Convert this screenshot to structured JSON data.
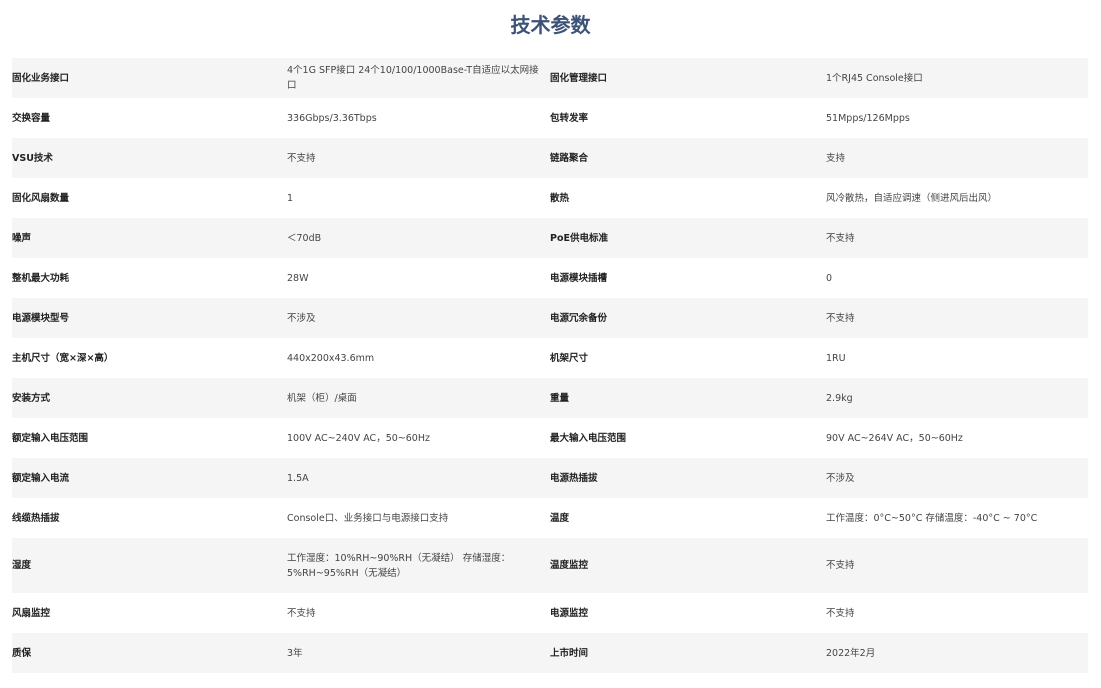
{
  "page": {
    "title": "技术参数"
  },
  "specs": [
    {
      "k1": "固化业务接口",
      "v1": "4个1G SFP接口 24个10/100/1000Base-T自适应以太网接口",
      "k2": "固化管理接口",
      "v2": "1个RJ45 Console接口"
    },
    {
      "k1": "交换容量",
      "v1": "336Gbps/3.36Tbps",
      "k2": "包转发率",
      "v2": "51Mpps/126Mpps"
    },
    {
      "k1": "VSU技术",
      "v1": "不支持",
      "k2": "链路聚合",
      "v2": "支持"
    },
    {
      "k1": "固化风扇数量",
      "v1": "1",
      "k2": "散热",
      "v2": "风冷散热，自适应调速（侧进风后出风）"
    },
    {
      "k1": "噪声",
      "v1": "＜70dB",
      "k2": "PoE供电标准",
      "v2": "不支持"
    },
    {
      "k1": "整机最大功耗",
      "v1": "28W",
      "k2": "电源模块插槽",
      "v2": "0"
    },
    {
      "k1": "电源模块型号",
      "v1": "不涉及",
      "k2": "电源冗余备份",
      "v2": "不支持"
    },
    {
      "k1": "主机尺寸（宽×深×高）",
      "v1": "440x200x43.6mm",
      "k2": "机架尺寸",
      "v2": "1RU"
    },
    {
      "k1": "安装方式",
      "v1": "机架（柜）/桌面",
      "k2": "重量",
      "v2": "2.9kg"
    },
    {
      "k1": "额定输入电压范围",
      "v1": "100V AC~240V AC，50~60Hz",
      "k2": "最大输入电压范围",
      "v2": "90V AC~264V AC，50~60Hz"
    },
    {
      "k1": "额定输入电流",
      "v1": "1.5A",
      "k2": "电源热插拔",
      "v2": "不涉及"
    },
    {
      "k1": "线缆热插拔",
      "v1": "Console口、业务接口与电源接口支持",
      "k2": "温度",
      "v2": "工作温度：0°C~50°C 存储温度：-40°C ~ 70°C"
    },
    {
      "k1": "湿度",
      "v1": "工作湿度：10%RH~90%RH（无凝结） 存储湿度：5%RH~95%RH（无凝结）",
      "k2": "温度监控",
      "v2": "不支持"
    },
    {
      "k1": "风扇监控",
      "v1": "不支持",
      "k2": "电源监控",
      "v2": "不支持"
    },
    {
      "k1": "质保",
      "v1": "3年",
      "k2": "上市时间",
      "v2": "2022年2月"
    }
  ]
}
